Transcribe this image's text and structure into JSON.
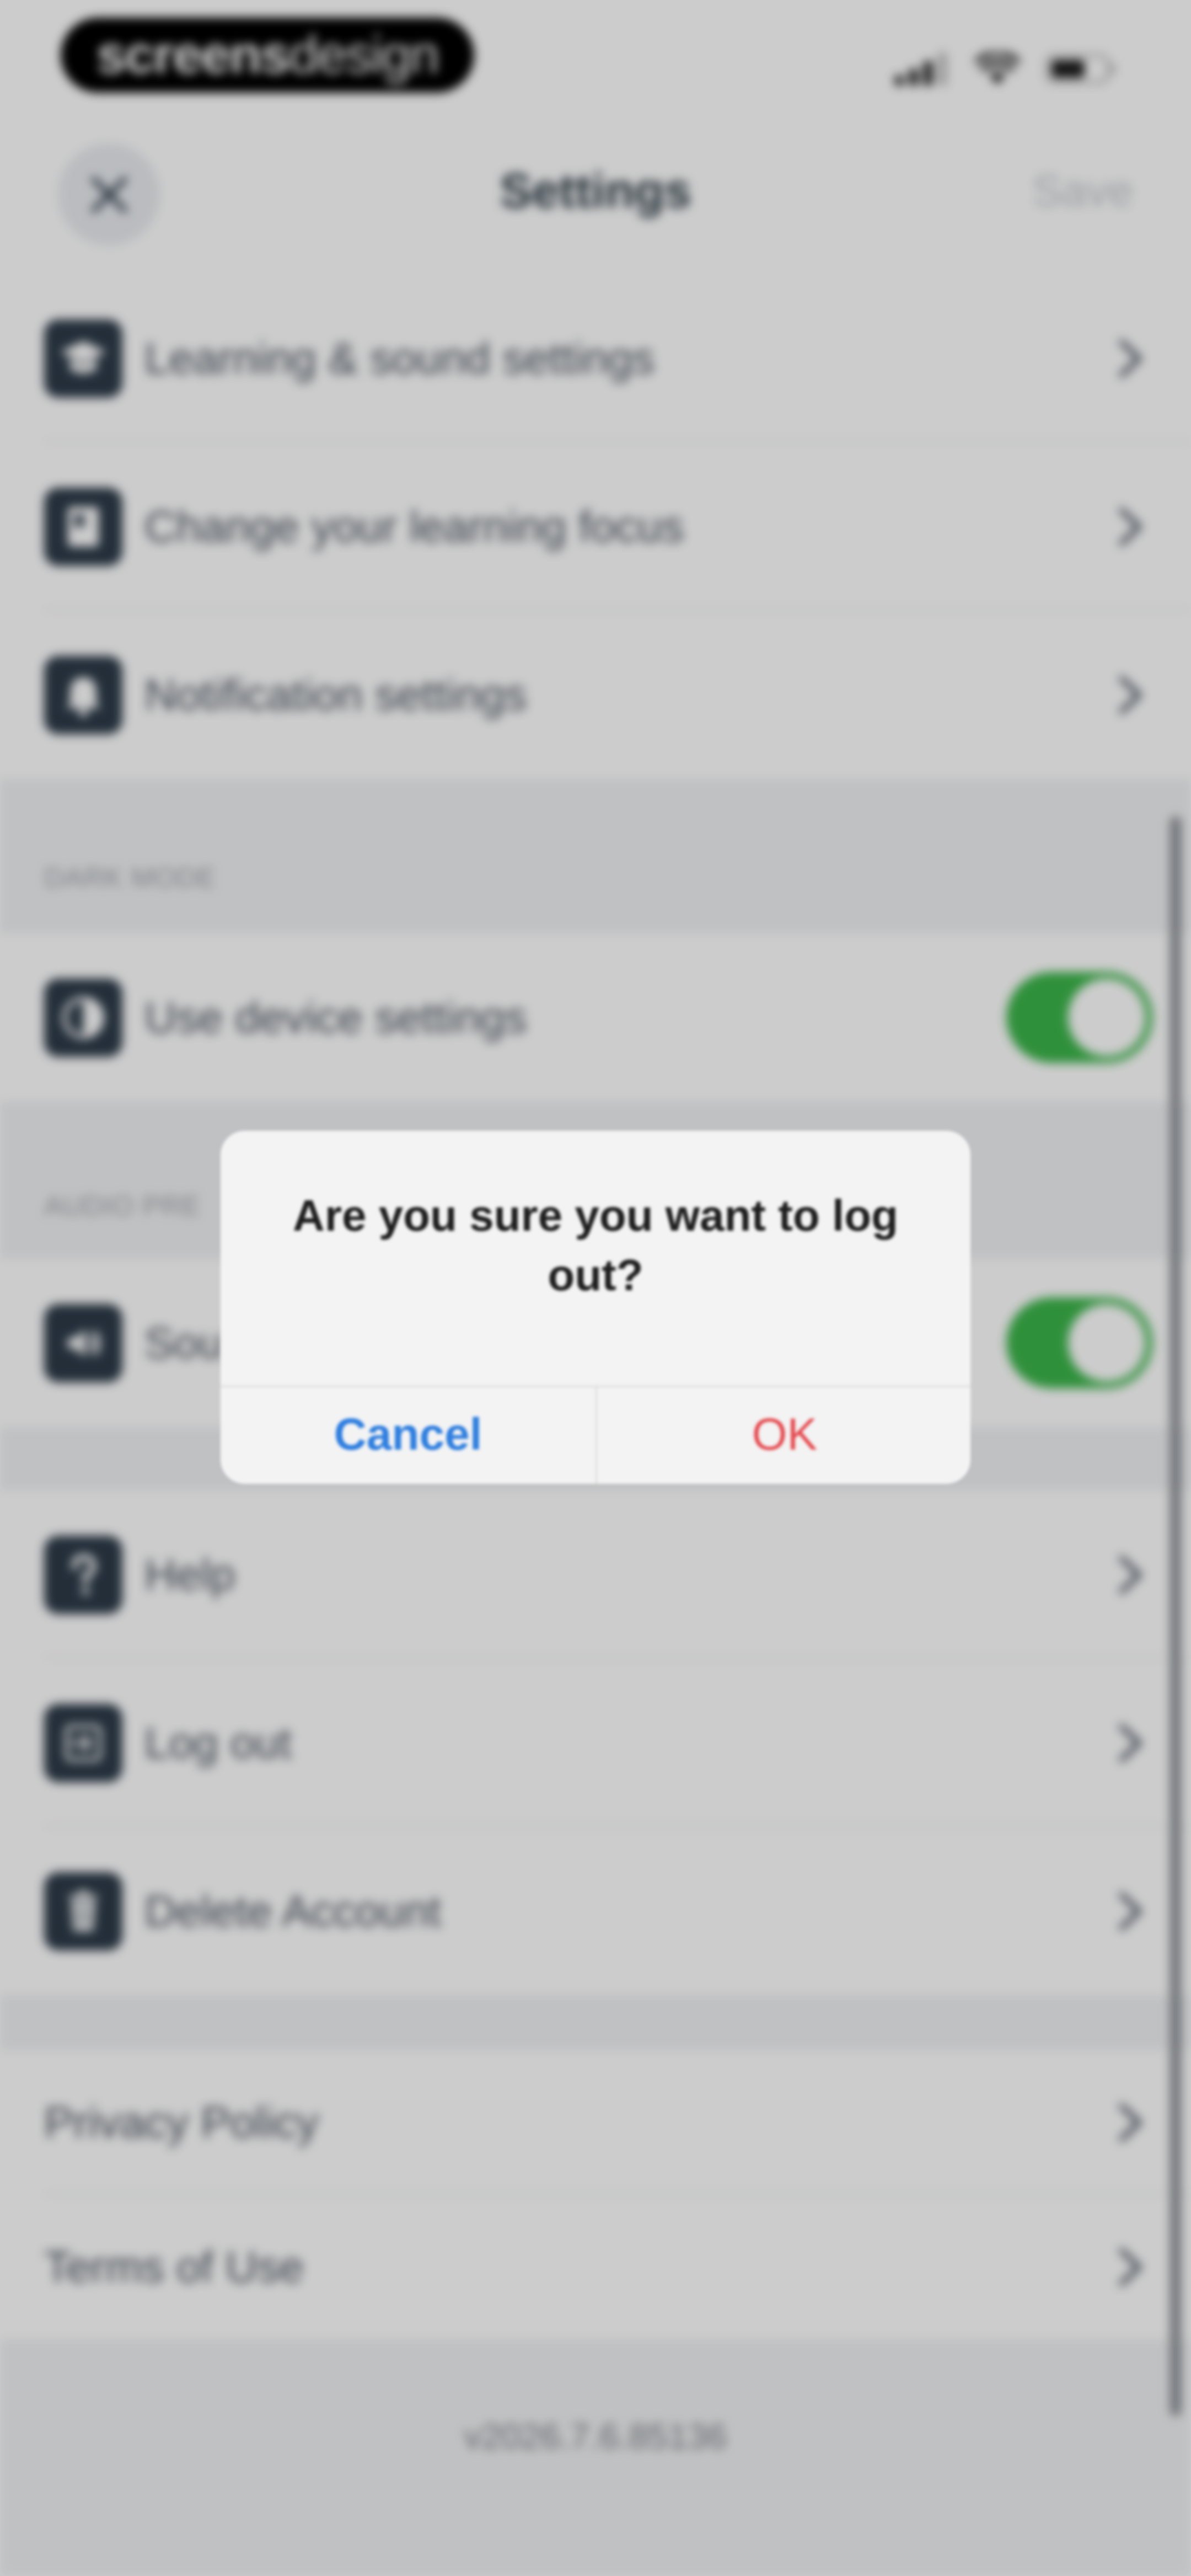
{
  "status_bar": {
    "brand_bold": "screens",
    "brand_light": "design"
  },
  "nav": {
    "title": "Settings",
    "save_label": "Save",
    "close_icon": "close-icon"
  },
  "learning_section": {
    "items": [
      {
        "label": "Learning & sound settings",
        "icon": "graduation-cap-icon"
      },
      {
        "label": "Change your learning focus",
        "icon": "book-icon"
      },
      {
        "label": "Notification settings",
        "icon": "bell-icon"
      }
    ]
  },
  "dark_mode": {
    "header": "DARK MODE",
    "item_label": "Use device settings",
    "enabled": true
  },
  "audio": {
    "header": "AUDIO PRE",
    "item_label": "Sou",
    "enabled": true
  },
  "account_section": {
    "items": [
      {
        "label": "Help",
        "icon": "help-icon"
      },
      {
        "label": "Log out",
        "icon": "logout-icon"
      },
      {
        "label": "Delete Account",
        "icon": "trash-icon"
      }
    ]
  },
  "legal_section": {
    "items": [
      {
        "label": "Privacy Policy"
      },
      {
        "label": "Terms of Use"
      }
    ]
  },
  "version": "v2026.7.6.85136",
  "alert": {
    "message": "Are you sure you want to log out?",
    "cancel_label": "Cancel",
    "ok_label": "OK"
  },
  "colors": {
    "accent_blue": "#2f7fe0",
    "destructive_red": "#e5484d",
    "toggle_green": "#3bb54a",
    "icon_dark": "#2c3a48"
  }
}
